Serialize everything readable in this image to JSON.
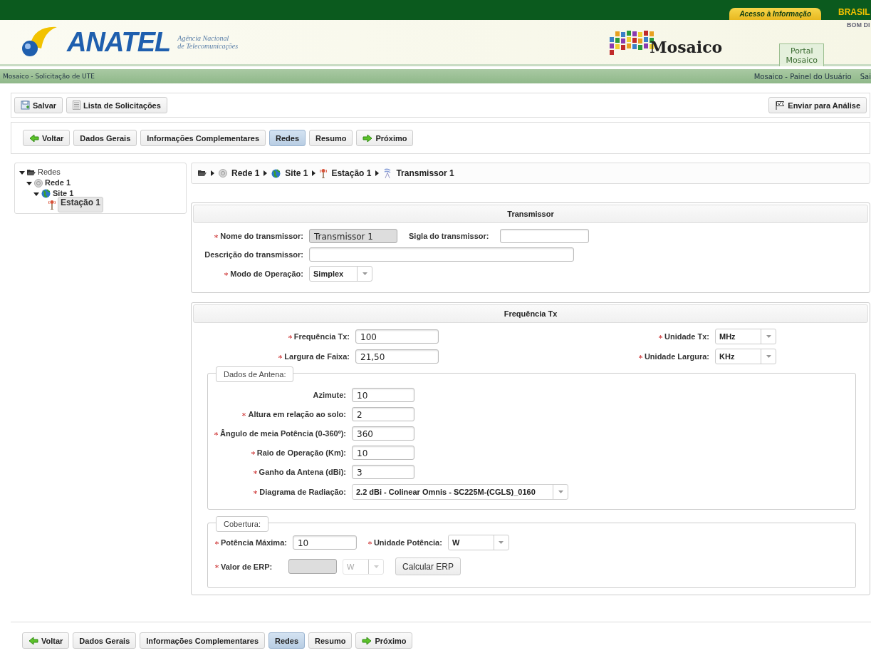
{
  "gov_bar": {
    "access_link": "Acesso à Informação",
    "brand": "BRASIL",
    "brand_sub": "BOM DI"
  },
  "header": {
    "logo": "ANATEL",
    "agency_line1": "Agência Nacional",
    "agency_line2": "de Telecomunicações",
    "app_name": "Mosaico",
    "portal_tab": [
      "Portal",
      "Mosaico"
    ]
  },
  "sub_bar": {
    "page_title": "Mosaico - Solicitação de UTE",
    "links": [
      "Mosaico - Painel do Usuário",
      "Sai"
    ]
  },
  "toolbar": {
    "buttons": [
      "Salvar",
      "Lista de Solicitações"
    ],
    "submit": "Enviar para Análise"
  },
  "nav_top": [
    {
      "label": "Voltar",
      "kind": "back",
      "selected": false
    },
    {
      "label": "Dados Gerais",
      "kind": "tab",
      "selected": false
    },
    {
      "label": "Informações Complementares",
      "kind": "tab",
      "selected": false
    },
    {
      "label": "Redes",
      "kind": "tab",
      "selected": true
    },
    {
      "label": "Resumo",
      "kind": "tab",
      "selected": false
    },
    {
      "label": "Próximo",
      "kind": "next",
      "selected": false
    }
  ],
  "tree": [
    {
      "label": "Redes",
      "expanded": true,
      "selected": false,
      "children": [
        {
          "label": "Rede 1",
          "expanded": true,
          "selected": false,
          "children": [
            {
              "label": "Site 1",
              "expanded": true,
              "selected": false,
              "children": [
                {
                  "label": "Estação 1",
                  "selected": true
                }
              ]
            }
          ]
        }
      ]
    }
  ],
  "breadcrumb": [
    "Rede 1",
    "Site 1",
    "Estação 1",
    "Transmissor 1"
  ],
  "transmissor": {
    "title": "Transmissor",
    "fields": [
      {
        "label": "Nome do transmissor:",
        "required": true,
        "kind": "readonly",
        "value": "Transmissor  1"
      },
      {
        "label": "Sigla do transmissor:",
        "required": false,
        "kind": "text"
      },
      {
        "label": "Descrição do transmissor:",
        "required": false,
        "kind": "text"
      },
      {
        "label": "Modo de Operação:",
        "required": true,
        "kind": "select",
        "value": "Simplex"
      }
    ]
  },
  "frequencia": {
    "title": "Frequência Tx",
    "left": [
      {
        "label": "Frequência Tx:",
        "required": true,
        "value": "100"
      },
      {
        "label": "Largura de Faixa:",
        "required": true,
        "value": "21,50"
      }
    ],
    "right": [
      {
        "label": "Unidade Tx:",
        "required": true,
        "value": "MHz"
      },
      {
        "label": "Unidade Largura:",
        "required": true,
        "value": "KHz"
      }
    ],
    "antena": {
      "legend": "Dados de Antena:",
      "fields": [
        {
          "label": "Azimute:",
          "required": false,
          "kind": "text",
          "value": "10"
        },
        {
          "label": "Altura em relação ao solo:",
          "required": true,
          "kind": "text",
          "value": "2"
        },
        {
          "label": "Ângulo de meia Potência (0-360º):",
          "required": true,
          "kind": "text",
          "value": "360"
        },
        {
          "label": "Raio de Operação (Km):",
          "required": true,
          "kind": "text",
          "value": "10"
        },
        {
          "label": "Ganho da Antena (dBi):",
          "required": true,
          "kind": "text",
          "value": "3"
        },
        {
          "label": "Diagrama de Radiação:",
          "required": true,
          "kind": "select",
          "value": "2.2 dBi - Colinear Omnis - SC225M-(CGLS)_0160"
        }
      ]
    },
    "cobertura": {
      "legend": "Cobertura:",
      "potencia": {
        "label": "Potência Máxima:",
        "required": true,
        "value": "10"
      },
      "unidade": {
        "label": "Unidade Potência:",
        "required": true,
        "value": "W"
      },
      "erp": {
        "label": "Valor de ERP:",
        "required": true,
        "readonly": true
      },
      "erp_unit": {
        "value": "W",
        "disabled": true
      },
      "button": "Calcular ERP"
    }
  },
  "nav_bottom": [
    {
      "label": "Voltar",
      "kind": "back",
      "selected": false
    },
    {
      "label": "Dados Gerais",
      "kind": "tab",
      "selected": false
    },
    {
      "label": "Informações Complementares",
      "kind": "tab",
      "selected": false
    },
    {
      "label": "Redes",
      "kind": "tab",
      "selected": true
    },
    {
      "label": "Resumo",
      "kind": "tab",
      "selected": false
    },
    {
      "label": "Próximo",
      "kind": "next",
      "selected": false
    }
  ]
}
